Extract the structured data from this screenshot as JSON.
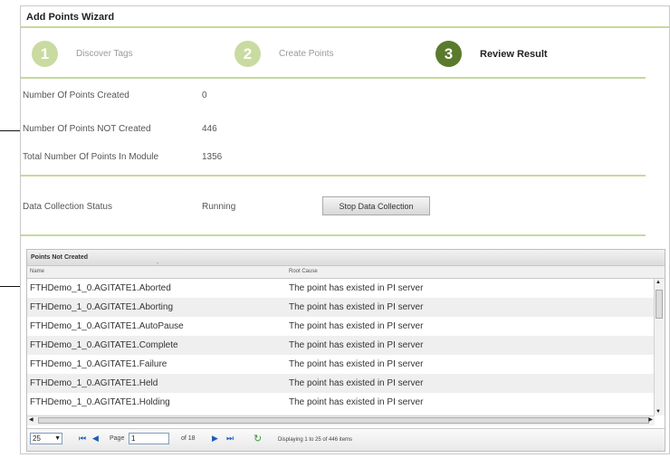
{
  "wizard": {
    "title": "Add Points Wizard",
    "steps": [
      {
        "number": "1",
        "label": "Discover Tags"
      },
      {
        "number": "2",
        "label": "Create Points"
      },
      {
        "number": "3",
        "label": "Review Result"
      }
    ],
    "active_step": 3
  },
  "summary": {
    "created_label": "Number Of Points Created",
    "created_value": "0",
    "not_created_label": "Number Of Points NOT Created",
    "not_created_value": "446",
    "total_label": "Total Number Of Points In Module",
    "total_value": "1356"
  },
  "collection": {
    "label": "Data Collection Status",
    "status": "Running",
    "button_label": "Stop Data Collection"
  },
  "grid": {
    "title": "Points Not Created",
    "columns": [
      "Name",
      "Root Cause"
    ],
    "rows": [
      [
        "FTHDemo_1_0.AGITATE1.Aborted",
        "The point has existed in PI server"
      ],
      [
        "FTHDemo_1_0.AGITATE1.Aborting",
        "The point has existed in PI server"
      ],
      [
        "FTHDemo_1_0.AGITATE1.AutoPause",
        "The point has existed in PI server"
      ],
      [
        "FTHDemo_1_0.AGITATE1.Complete",
        "The point has existed in PI server"
      ],
      [
        "FTHDemo_1_0.AGITATE1.Failure",
        "The point has existed in PI server"
      ],
      [
        "FTHDemo_1_0.AGITATE1.Held",
        "The point has existed in PI server"
      ],
      [
        "FTHDemo_1_0.AGITATE1.Holding",
        "The point has existed in PI server"
      ]
    ]
  },
  "pager": {
    "page_size": "25",
    "page_label": "Page",
    "page_value": "1",
    "of_label": "of 18",
    "display_text": "Displaying 1 to 25 of 446 items"
  }
}
